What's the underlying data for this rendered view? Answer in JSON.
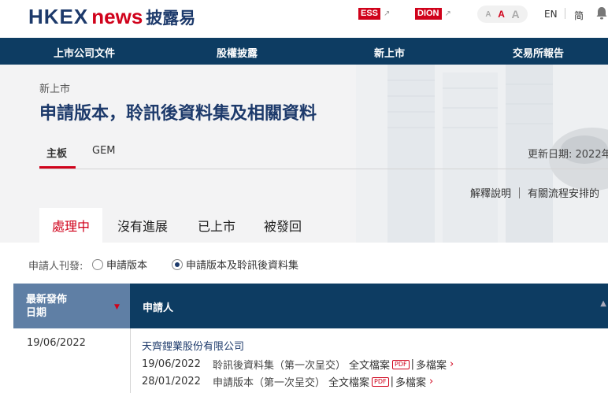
{
  "header": {
    "logo_hkex": "HKEX",
    "logo_news": "news",
    "logo_cn": "披露易",
    "ess": "ESS",
    "dion": "DION",
    "font_sizes": [
      "A",
      "A",
      "A"
    ],
    "lang_en": "EN",
    "lang_sc": "简"
  },
  "nav": {
    "items": [
      "上市公司文件",
      "股權披露",
      "新上市",
      "交易所報告"
    ]
  },
  "page": {
    "breadcrumb": "新上市",
    "title": "申請版本，聆訊後資料集及相關資料",
    "board_tabs": [
      "主板",
      "GEM"
    ],
    "updated": "更新日期: 2022年",
    "link_explain": "解釋說明",
    "link_process": "有關流程安排的",
    "status_tabs": [
      "處理中",
      "沒有進展",
      "已上市",
      "被發回"
    ]
  },
  "filter": {
    "label": "申請人刊發:",
    "option1": "申請版本",
    "option2": "申請版本及聆訊後資料集"
  },
  "table": {
    "col_date": "最新發佈日期",
    "col_date_line1": "最新發佈",
    "col_date_line2": "日期",
    "col_applicant": "申請人",
    "rows": [
      {
        "date": "19/06/2022",
        "company": "天齊鋰業股份有限公司",
        "docs": [
          {
            "date": "19/06/2022",
            "type": "聆訊後資料集（第一次呈交）",
            "full": "全文檔案",
            "pdf": "PDF",
            "multi": "多檔案"
          },
          {
            "date": "28/01/2022",
            "type": "申請版本（第一次呈交）",
            "full": "全文檔案",
            "pdf": "PDF",
            "multi": "多檔案"
          }
        ]
      }
    ]
  },
  "colors": {
    "navy": "#0d3c62",
    "red": "#d0021b",
    "header_light": "#5f7fa5"
  }
}
